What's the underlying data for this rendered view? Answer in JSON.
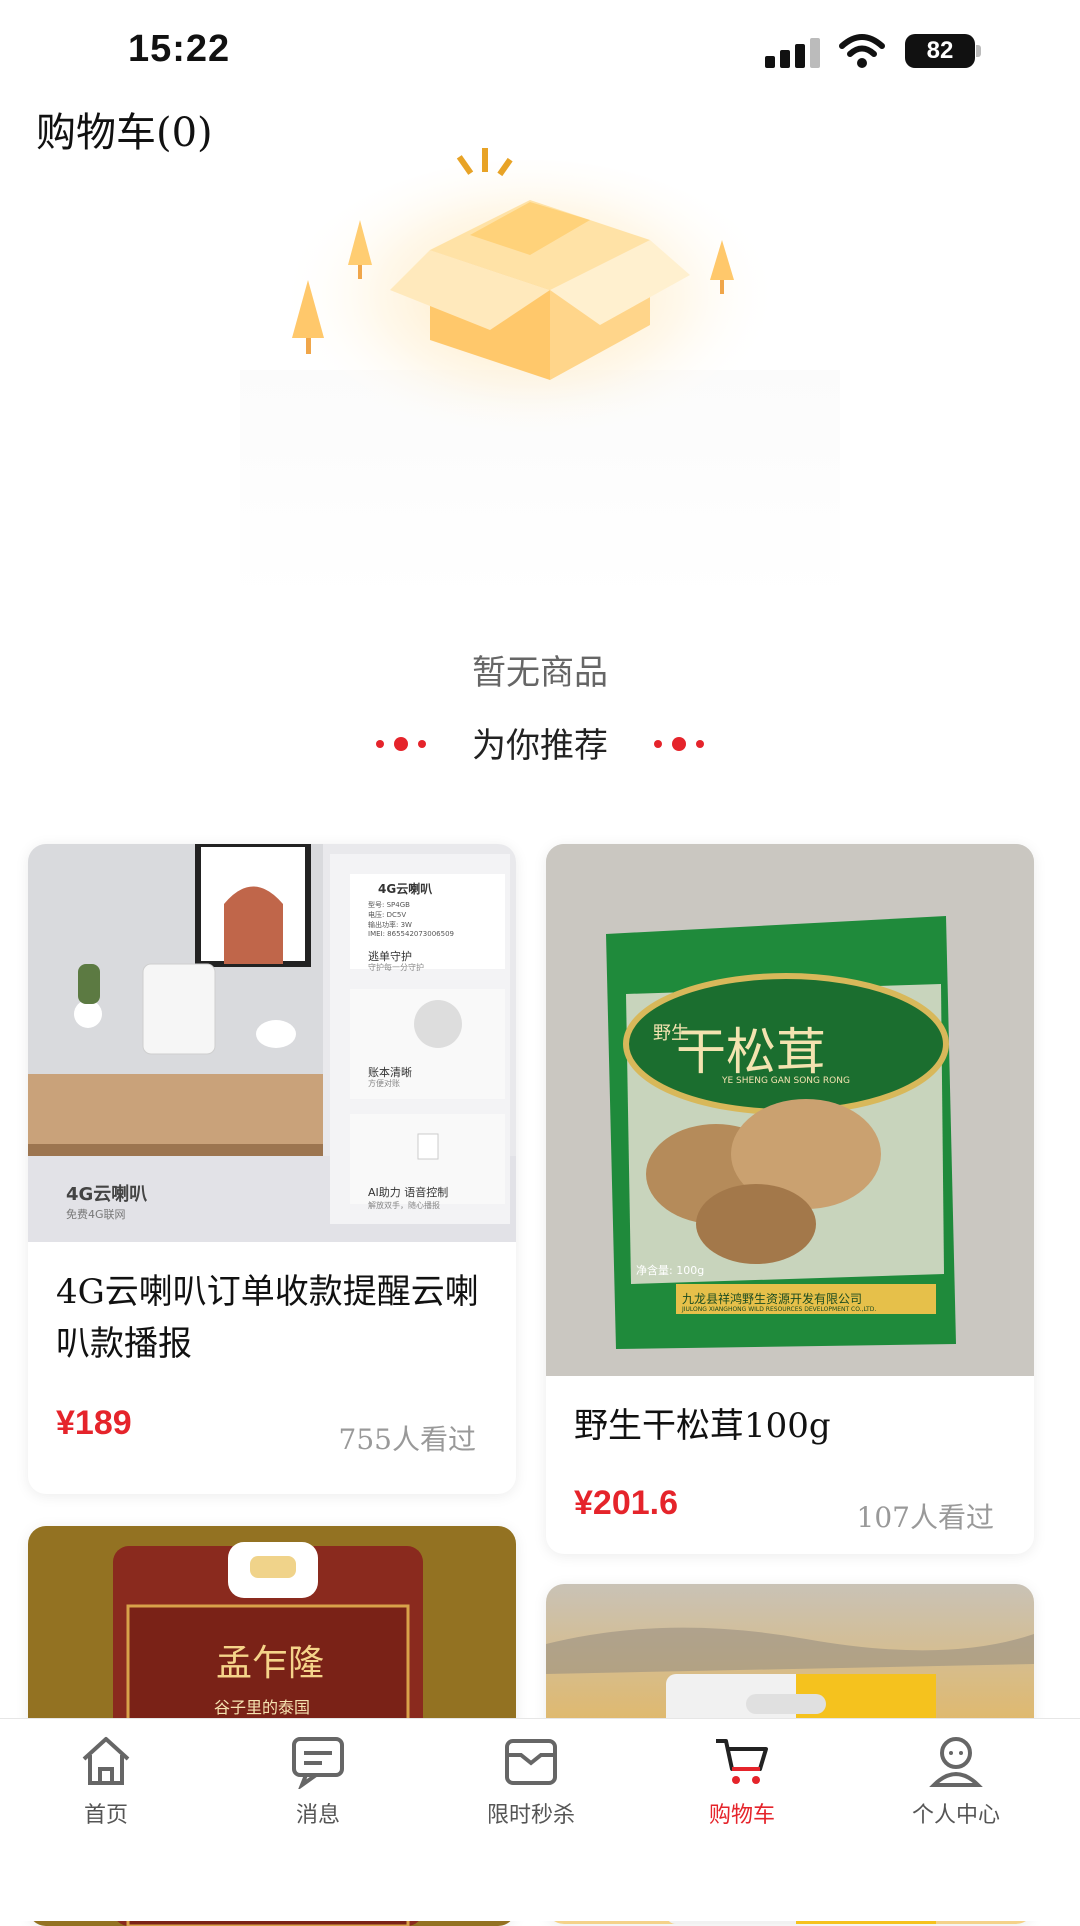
{
  "status_bar": {
    "time": "15:22",
    "battery": "82"
  },
  "header": {
    "title": "购物车(0)"
  },
  "empty_state": {
    "text": "暂无商品"
  },
  "recommend": {
    "title": "为你推荐"
  },
  "products": [
    {
      "name": "4G云喇叭订单收款提醒云喇叭款播报",
      "price": "¥189",
      "views": "755人看过",
      "image_text": {
        "title": "4G云喇叭",
        "subtitle": "免费4G联网",
        "panel1": "逃单守护",
        "panel1_sub": "守护每一分守护",
        "panel2": "账本清晰",
        "panel2_sub": "方便对账",
        "panel3": "AI助力 语音控制",
        "panel3_sub": "解放双手，随心播报",
        "spec_title": "4G云喇叭",
        "spec_lines": [
          "型号: SP4GB",
          "电压: DC5V",
          "输出功率: 3W",
          "IMEI: 865542073006509"
        ]
      }
    },
    {
      "name": "野生干松茸100g",
      "price": "¥201.6",
      "views": "107人看过",
      "image_text": {
        "brand": "干松茸",
        "brand_prefix": "野生",
        "pinyin": "YE SHENG GAN SONG RONG",
        "weight": "净含量: 100g",
        "company": "九龙县祥鸿野生资源开发有限公司",
        "company_en": "JIULONG XIANGHONG WILD RESOURCES DEVELOPMENT CO.,LTD."
      }
    },
    {
      "name": "",
      "image_text": {
        "brand": "孟乍隆",
        "tagline": "谷子里的泰国"
      }
    },
    {
      "name": "",
      "image_text": {}
    }
  ],
  "tabbar": {
    "items": [
      {
        "label": "首页",
        "icon": "home-icon"
      },
      {
        "label": "消息",
        "icon": "message-icon"
      },
      {
        "label": "限时秒杀",
        "icon": "flash-sale-icon"
      },
      {
        "label": "购物车",
        "icon": "cart-icon",
        "active": true
      },
      {
        "label": "个人中心",
        "icon": "profile-icon"
      }
    ]
  },
  "colors": {
    "accent": "#e5242b",
    "box": "#ffc86b"
  }
}
